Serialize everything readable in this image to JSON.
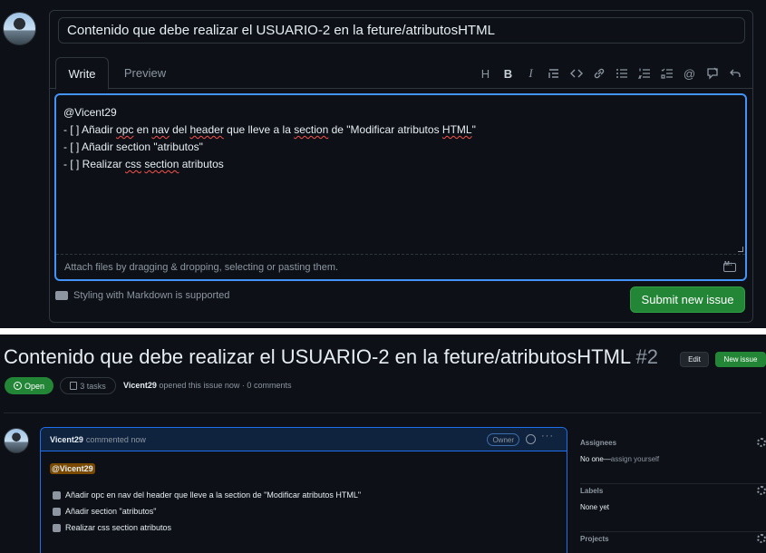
{
  "new_issue": {
    "title_value": "Contenido que debe realizar el USUARIO-2 en la feture/atributosHTML",
    "tabs": {
      "write": "Write",
      "preview": "Preview"
    },
    "toolbar": [
      "heading-icon",
      "bold-icon",
      "italic-icon",
      "quote-icon",
      "code-icon",
      "link-icon",
      "bulleted-list-icon",
      "numbered-list-icon",
      "task-list-icon",
      "mention-icon",
      "reference-icon",
      "undo-icon"
    ],
    "toolbar_glyphs": {
      "heading": "H",
      "bold": "B",
      "italic": "I",
      "mention": "@"
    },
    "body_lines": {
      "l1": "@Vicent29",
      "l2_a": "- [ ] Añadir ",
      "l2_b": "opc",
      "l2_c": " en ",
      "l2_d": "nav",
      "l2_e": " del ",
      "l2_f": "header",
      "l2_g": " que lleve a la ",
      "l2_h": "section",
      "l2_i": " de \"Modificar atributos ",
      "l2_j": "HTML",
      "l2_k": "\"",
      "l3_a": "- [ ] Añadir section \"atributos\"",
      "l4_a": "- [ ] Realizar ",
      "l4_b": "css",
      "l4_c": " ",
      "l4_d": "section",
      "l4_e": " atributos"
    },
    "attach_hint": "Attach files by dragging & dropping, selecting or pasting them.",
    "markdown_note": "Styling with Markdown is supported",
    "submit_label": "Submit new issue"
  },
  "issue": {
    "title": "Contenido que debe realizar el USUARIO-2 en la feture/atributosHTML",
    "number": "#2",
    "edit_label": "Edit",
    "new_issue_label": "New issue",
    "state": "Open",
    "tasks": "3 tasks",
    "author": "Vicent29",
    "meta_rest": "opened this issue now · 0 comments",
    "comment": {
      "author": "Vicent29",
      "time": "commented now",
      "owner_badge": "Owner",
      "mention": "@Vicent29",
      "tasks": [
        "Añadir opc en nav del header que lleve a la section de \"Modificar atributos HTML\"",
        "Añadir section \"atributos\"",
        "Realizar css section atributos"
      ]
    },
    "sidebar": {
      "assignees_title": "Assignees",
      "assignees_value": "No one—",
      "assignees_link": "assign yourself",
      "labels_title": "Labels",
      "labels_value": "None yet",
      "projects_title": "Projects"
    }
  },
  "colors": {
    "background": "#0d1117",
    "border": "#30363d",
    "accent_blue": "#4493f8",
    "green": "#238636",
    "muted_text": "#8d96a0"
  }
}
